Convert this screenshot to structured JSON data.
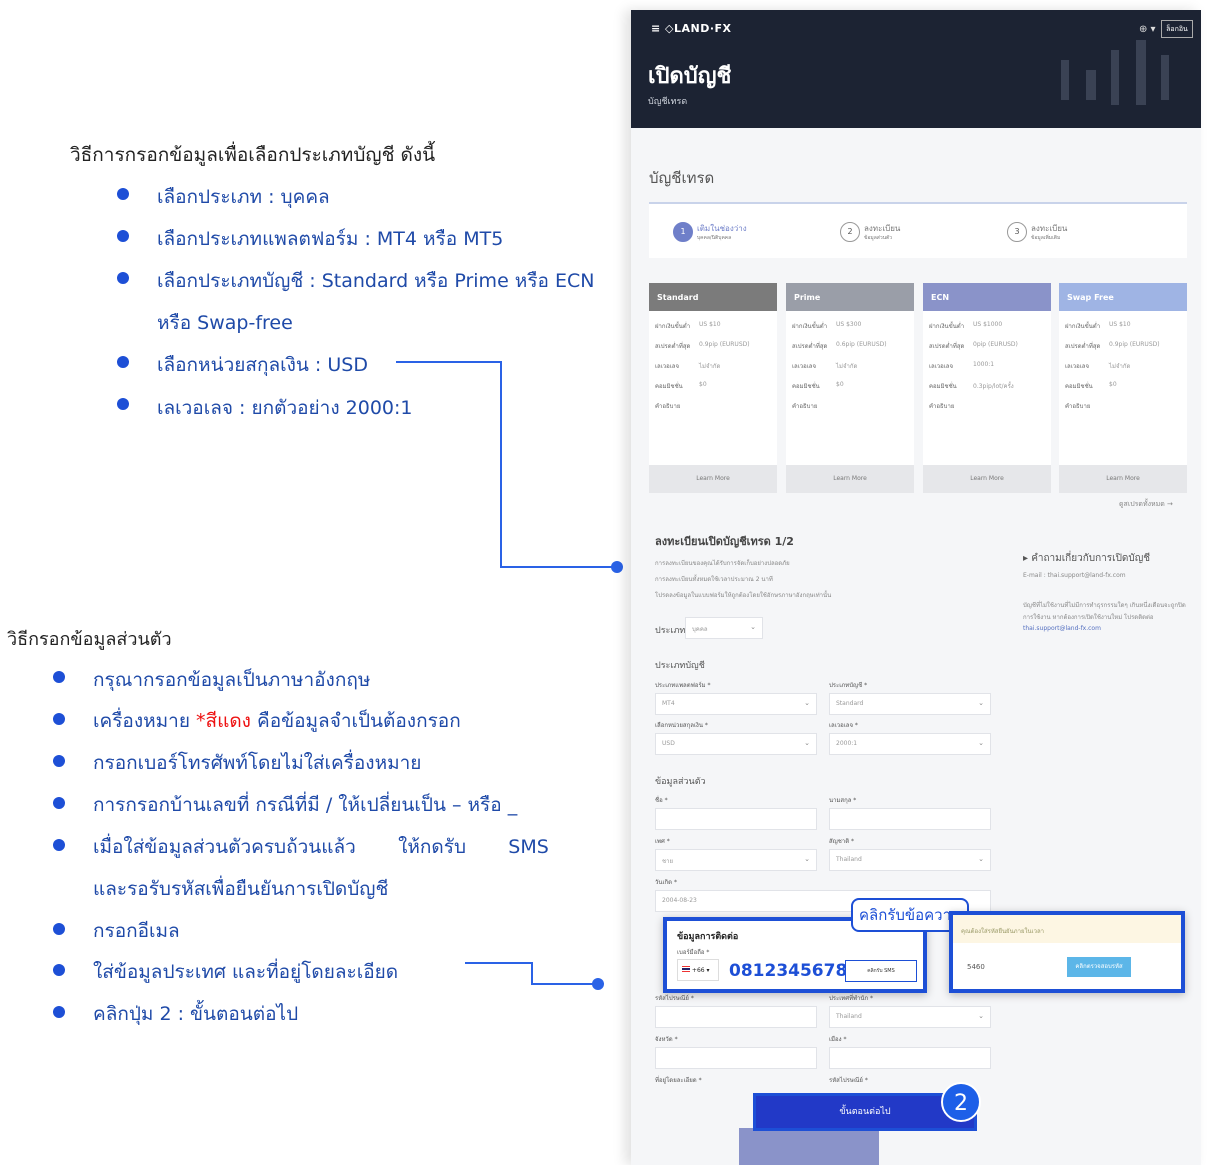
{
  "left": {
    "section1_heading": "วิธีการกรอกข้อมูลเพื่อเลือกประเภทบัญชี ดังนี้",
    "section1_items": [
      "เลือกประเภท :   บุคคล",
      "เลือกประเภทแพลตฟอร์ม : MT4 หรือ MT5",
      "เลือกประเภทบัญชี : Standard หรือ Prime หรือ ECN",
      "หรือ Swap-free",
      "เลือกหน่วยสกุลเงิน : USD",
      "เลเวอเลจ : ยกตัวอย่าง 2000:1"
    ],
    "section2_heading": "วิธีกรอกข้อมูลส่วนตัว",
    "section2_items": [
      "กรุณากรอกข้อมูลเป็นภาษาอังกฤษ",
      "เครื่องหมาย",
      "*สีแดง",
      "คือข้อมูลจำเป็นต้องกรอก",
      "กรอกเบอร์โทรศัพท์โดยไม่ใส่เครื่องหมาย",
      "การกรอกบ้านเลขที่ กรณีที่มี / ให้เปลี่ยนเป็น – หรือ _",
      "เมื่อใส่ข้อมูลส่วนตัวครบถ้วนแล้ว       ให้กดรับ       SMS",
      "และรอรับรหัสเพื่อยืนยันการเปิดบัญชี",
      "กรอกอีเมล",
      "ใส่ข้อมูลประเทศ และที่อยู่โดยละเอียด",
      "คลิกปุ่ม 2 : ขั้นตอนต่อไป"
    ]
  },
  "site": {
    "logo": "≡ ◇LAND·FX",
    "login": "ล็อกอิน",
    "title": "เปิดบัญชี",
    "subtitle": "บัญชีเทรด",
    "section_title": "บัญชีเทรด",
    "steps": [
      {
        "num": "1",
        "label": "เติมในช่องว่าง",
        "sub": "บุคคล/นิติบุคคล"
      },
      {
        "num": "2",
        "label": "ลงทะเบียน",
        "sub": "ข้อมูลส่วนตัว"
      },
      {
        "num": "3",
        "label": "ลงทะเบียน",
        "sub": "ข้อมูลเพิ่มเติม"
      }
    ],
    "accounts": [
      {
        "name": "Standard",
        "color": "#7b7b7b",
        "vals": [
          "US $10",
          "0.9pip (EURUSD)",
          "ไม่จำกัด",
          "$0"
        ]
      },
      {
        "name": "Prime",
        "color": "#9a9ea8",
        "vals": [
          "US $300",
          "0.6pip (EURUSD)",
          "ไม่จำกัด",
          "$0"
        ]
      },
      {
        "name": "ECN",
        "color": "#8a93c9",
        "vals": [
          "US $1000",
          "0pip (EURUSD)",
          "1000:1",
          "0.3pip/lot/ครั้ง"
        ]
      },
      {
        "name": "Swap Free",
        "color": "#9fb4e4",
        "vals": [
          "US $10",
          "0.9pip (EURUSD)",
          "ไม่จำกัด",
          "$0"
        ]
      }
    ],
    "acct_rows": [
      "ฝากเงินขั้นต่ำ",
      "สเปรดต่ำที่สุด",
      "เลเวอเลจ",
      "คอมมิชชั่น",
      "คำอธิบาย"
    ],
    "learn_more": "Learn More",
    "compare": "ดูสเปรดทั้งหมด →",
    "reg_title": "ลงทะเบียนเปิดบัญชีเทรด 1/2",
    "reg_notes": [
      "การลงทะเบียนของคุณได้รับการจัดเก็บอย่างปลอดภัย",
      "การลงทะเบียนทั้งหมดใช้เวลาประมาณ 2 นาที",
      "โปรดลงข้อมูลในแบบฟอร์มให้ถูกต้องโดยใช้อักษรภาษาอังกฤษเท่านั้น"
    ],
    "faq_title": "▸ คำถามเกี่ยวกับการเปิดบัญชี",
    "faq_email": "E-mail : thai.support@land-fx.com",
    "faq_note": "บัญชีที่ไม่ใช้งานที่ไม่มีการทำธุรกรรมใดๆ เกินหนึ่งเดือนจะถูกปิดการใช้งาน หากต้องการเปิดใช้งานใหม่ โปรดติดต่อ",
    "faq_email2": "thai.support@land-fx.com",
    "type_label": "ประเภท",
    "type_value": "บุคคล",
    "acct_type_heading": "ประเภทบัญชี",
    "platform_label": "ประเภทแพลตฟอร์ม *",
    "platform_value": "MT4",
    "acct_label": "ประเภทบัญชี *",
    "acct_value": "Standard",
    "currency_label": "เลือกหน่วยสกุลเงิน *",
    "currency_value": "USD",
    "leverage_label": "เลเวอเลจ *",
    "leverage_value": "2000:1",
    "personal_heading": "ข้อมูลส่วนตัว",
    "firstname_label": "ชื่อ *",
    "lastname_label": "นามสกุล *",
    "gender_label": "เพศ *",
    "gender_value": "ชาย",
    "nationality_label": "สัญชาติ *",
    "nationality_value": "Thailand",
    "dob_label": "วันเกิด *",
    "dob_value": "2004-08-23",
    "contact_title": "ข้อมูลการติดต่อ",
    "phone_label": "เบอร์มือถือ *",
    "phone_code": "+66",
    "phone_value": "0812345678",
    "sms_button": "คลิกรับ SMS",
    "sms_callout": "คลิกรับข้อความ",
    "verify_note": "คุณต้องใส่รหัสยืนยันภายในเวลา",
    "verify_code": "5460",
    "verify_button": "คลิกตรวจสอบรหัส",
    "zipcode_label": "รหัสไปรษณีย์ *",
    "country_label": "ประเทศที่พำนัก *",
    "country_value": "Thailand",
    "province_label": "จังหวัด *",
    "city_label": "เมือง *",
    "address_label": "ที่อยู่โดยละเอียด *",
    "postcode_label": "รหัสไปรษณีย์ *",
    "next_button": "ขั้นตอนต่อไป",
    "badge": "2"
  }
}
